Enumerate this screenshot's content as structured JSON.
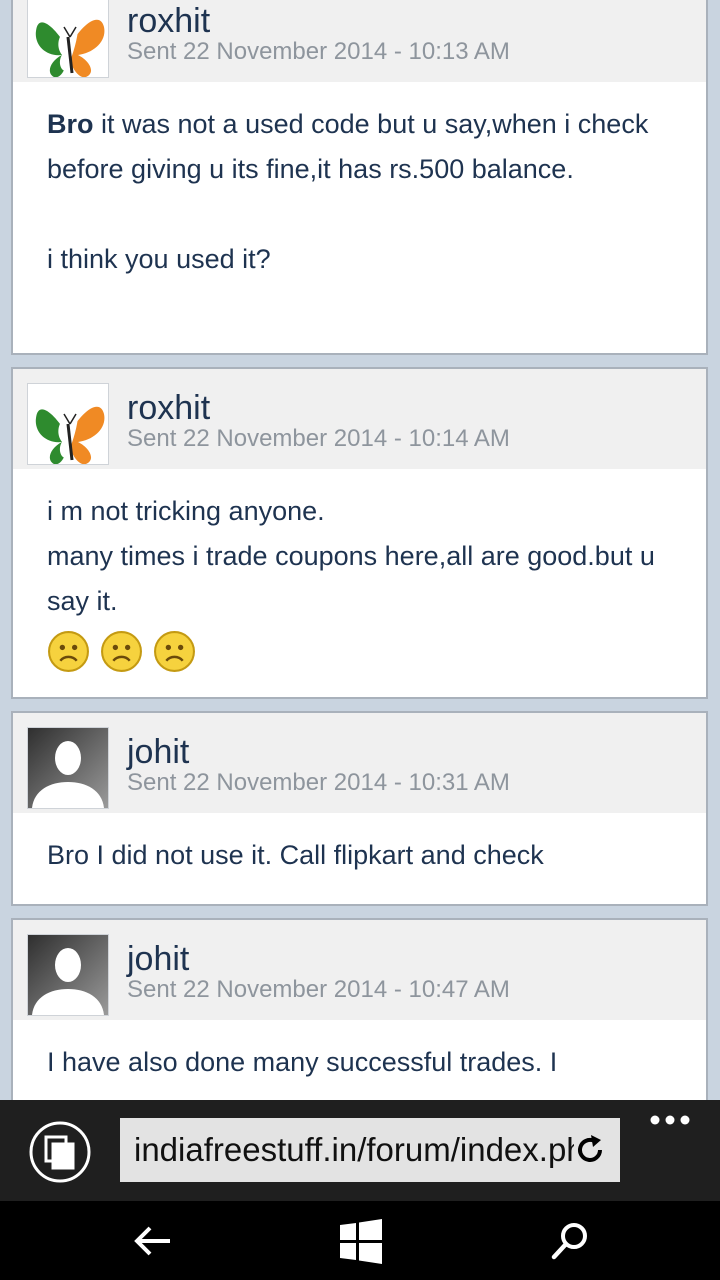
{
  "messages": [
    {
      "username": "roxhit",
      "sent": "Sent 22 November 2014 - 10:13 AM",
      "avatar": "butterfly-avatar",
      "body_bold": "Bro",
      "body_lines": [
        " it was not a used code but u say,when i check before giving u its fine,it has rs.500 balance.",
        "i think you used it?"
      ]
    },
    {
      "username": "roxhit",
      "sent": "Sent 22 November 2014 - 10:14 AM",
      "avatar": "butterfly-avatar",
      "body_lines": [
        "i m not tricking anyone.",
        "many times i trade coupons here,all are good.but u say it."
      ],
      "smilies": [
        "sad-smiley",
        "sad-smiley",
        "sad-smiley"
      ]
    },
    {
      "username": "johit",
      "sent": "Sent 22 November 2014 - 10:31 AM",
      "avatar": "default-user-avatar",
      "body_lines": [
        "Bro I did not use it. Call flipkart and check"
      ]
    },
    {
      "username": "johit",
      "sent": "Sent 22 November 2014 - 10:47 AM",
      "avatar": "default-user-avatar",
      "body_lines": [
        "I have also done many successful trades. I"
      ]
    }
  ],
  "browser": {
    "url": "indiafreestuff.in/forum/index.php",
    "tabs_icon": "tabs-icon",
    "refresh_icon": "refresh-icon",
    "more_icon": "more-options-icon"
  },
  "navbar": {
    "back_icon": "back-arrow-icon",
    "home_icon": "windows-logo-icon",
    "search_icon": "search-icon"
  },
  "colors": {
    "page_background": "#c9d4e0",
    "header_background": "#f0f0f0",
    "username_text": "#1e3350",
    "timestamp_text": "#8e959d",
    "address_bar": "#1f1f1f",
    "nav_bar": "#000000"
  }
}
